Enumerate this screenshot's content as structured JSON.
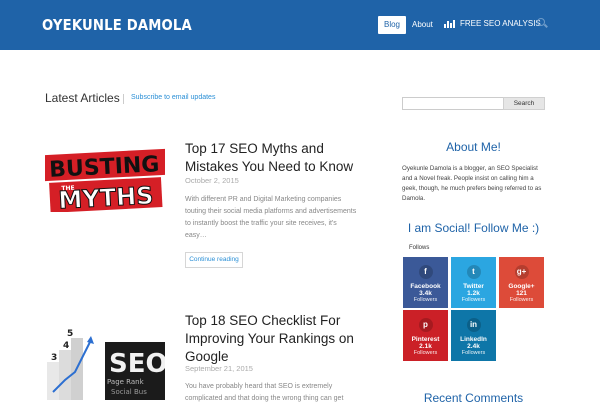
{
  "header": {
    "logo": "OYEKUNLE DAMOLA",
    "nav": {
      "blog": "Blog",
      "about": "About",
      "seo": "FREE SEO ANALYSIS"
    }
  },
  "main": {
    "heading": "Latest Articles",
    "subscribe": "Subscribe to email updates",
    "posts": [
      {
        "title": "Top 17 SEO Myths and Mistakes You Need to Know",
        "date": "October 2, 2015",
        "excerpt": "With different PR and Digital Marketing companies touting their social media platforms and advertisements to instantly boost the traffic your site receives, it's easy…",
        "read_more": "Continue reading",
        "image_text": "BUSTING THE MYTHS"
      },
      {
        "title": "Top 18 SEO Checklist For Improving Your Rankings on Google",
        "date": "September 21, 2015",
        "excerpt": "You have probably heard that SEO is extremely complicated and that doing the wrong thing can get",
        "image_text": "SEO"
      }
    ]
  },
  "sidebar": {
    "search_button": "Search",
    "about_title": "About Me!",
    "about_text": "Oyekunle Damola is a blogger, an SEO Specialist and a Novel freak. People insist on calling him a geek, though, he much prefers being referred to as Damola.",
    "social_title": "I am Social! Follow Me :)",
    "follows_label": "Follows",
    "tiles": {
      "facebook": {
        "name": "Facebook",
        "count": "3.4k",
        "label": "Followers"
      },
      "twitter": {
        "name": "Twitter",
        "count": "1.2k",
        "label": "Followers"
      },
      "googleplus": {
        "name": "Google+",
        "count": "121",
        "label": "Followers"
      },
      "pinterest": {
        "name": "Pinterest",
        "count": "2.1k",
        "label": "Followers"
      },
      "linkedin": {
        "name": "LinkedIn",
        "count": "2.4k",
        "label": "Followers"
      }
    },
    "comments_title": "Recent Comments"
  },
  "colors": {
    "header": "#1f63a8",
    "accent": "#2a8fd6"
  }
}
